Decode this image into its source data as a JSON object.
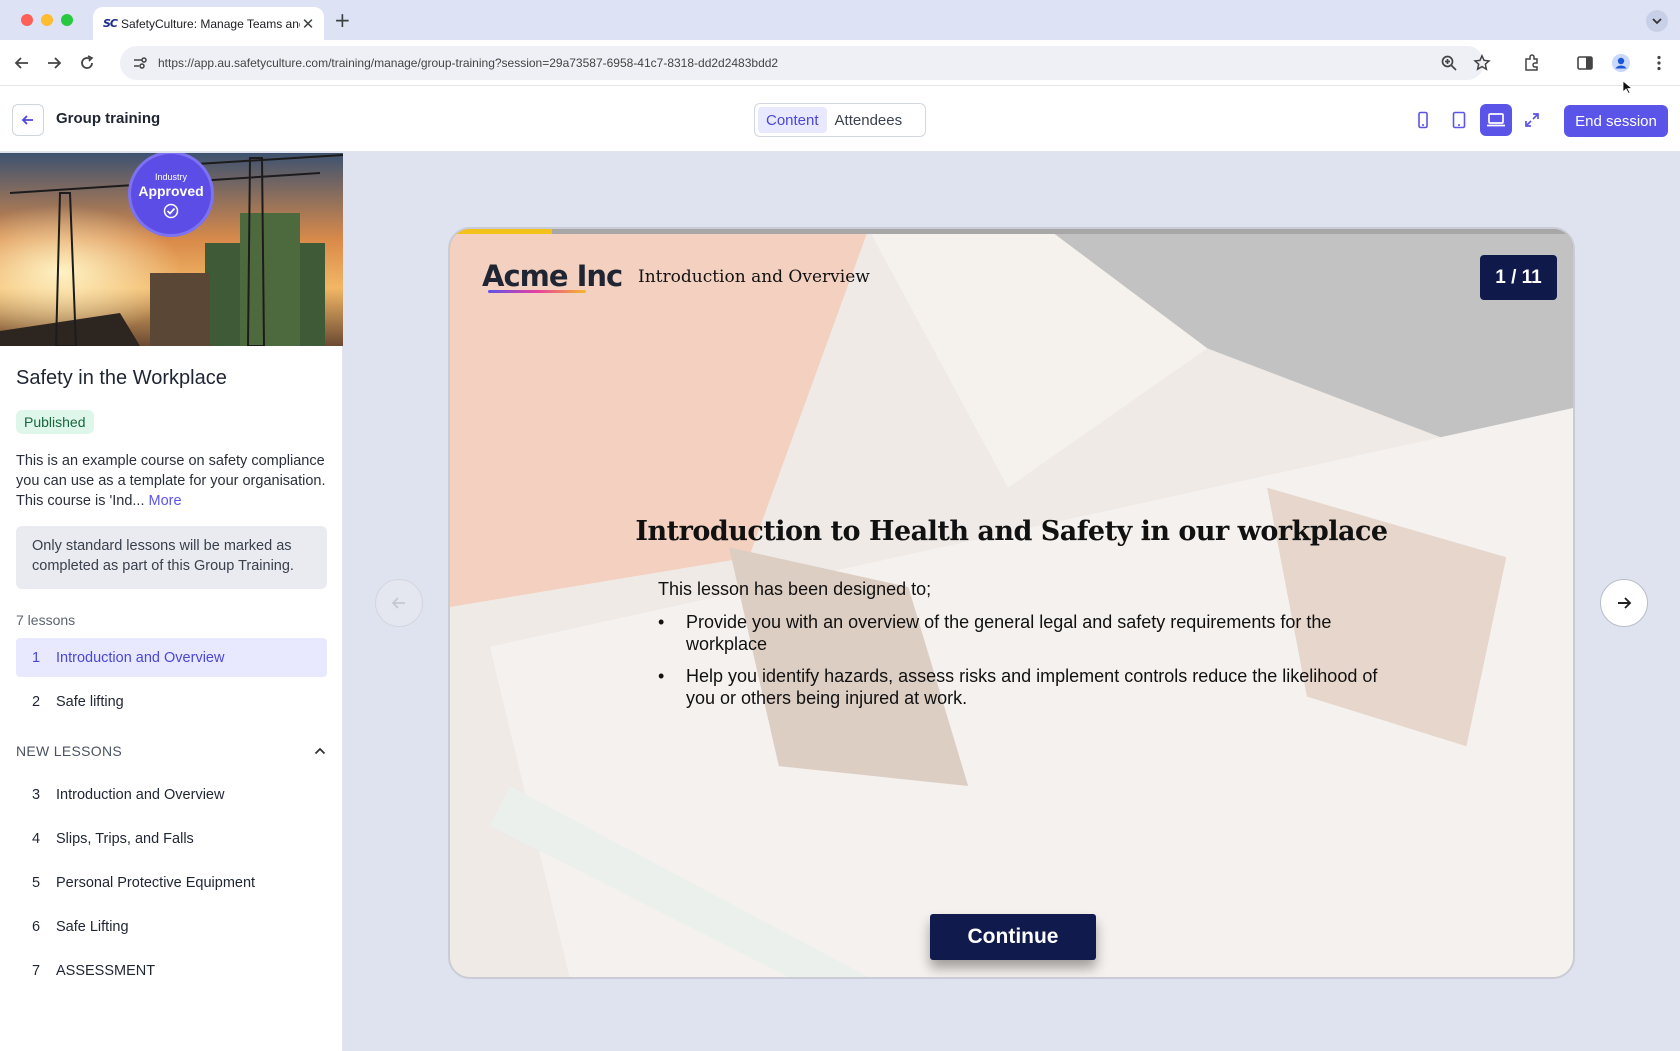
{
  "browser": {
    "tab_title": "SafetyCulture: Manage Teams and...",
    "tab_favicon": "SC",
    "url": "https://app.au.safetyculture.com/training/manage/group-training?session=29a73587-6958-41c7-8318-dd2d2483bdd2",
    "icons": [
      "back-icon",
      "forward-icon",
      "reload-icon",
      "site-settings-icon",
      "zoom-icon",
      "star-icon",
      "extensions-icon",
      "sidebar-icon",
      "profile-icon",
      "more-vert-icon"
    ]
  },
  "header": {
    "title": "Group training",
    "tabs": [
      {
        "label": "Content",
        "active": true
      },
      {
        "label": "Attendees",
        "active": false
      }
    ],
    "device_options": [
      "mobile-icon",
      "tablet-icon",
      "desktop-icon",
      "expand-icon"
    ],
    "end_session_label": "End session",
    "accent": "#5b54e8"
  },
  "sidebar": {
    "badge_small": "Industry",
    "badge_big": "Approved",
    "course_title": "Safety in the Workplace",
    "status": "Published",
    "description": "This is an example course on safety compliance you can use as a template for your organisation. This course is 'Ind...",
    "more_label": "More",
    "info": "Only standard lessons will be marked as completed as part of this Group Training.",
    "lessons_count": "7 lessons",
    "lessons": [
      {
        "num": "1",
        "title": "Introduction and Overview",
        "active": true
      },
      {
        "num": "2",
        "title": "Safe lifting",
        "active": false
      }
    ],
    "section_label": "NEW LESSONS",
    "new_lessons": [
      {
        "num": "3",
        "title": "Introduction and Overview"
      },
      {
        "num": "4",
        "title": "Slips, Trips, and Falls"
      },
      {
        "num": "5",
        "title": "Personal Protective Equipment"
      },
      {
        "num": "6",
        "title": "Safe Lifting"
      },
      {
        "num": "7",
        "title": "ASSESSMENT"
      }
    ]
  },
  "slide": {
    "brand": "Acme Inc",
    "lesson_title": "Introduction and Overview",
    "counter": "1 / 11",
    "progress_fraction": 0.091,
    "heading": "Introduction to Health and Safety in our workplace",
    "intro": "This lesson has been designed to;",
    "bullets": [
      "Provide you with an overview of the general legal and safety requirements for the workplace",
      "Help you identify hazards, assess risks and implement controls reduce the likelihood of you or others being injured at work."
    ],
    "continue_label": "Continue",
    "colors": {
      "progress": "#f2c21b",
      "navy": "#101a4c"
    }
  }
}
